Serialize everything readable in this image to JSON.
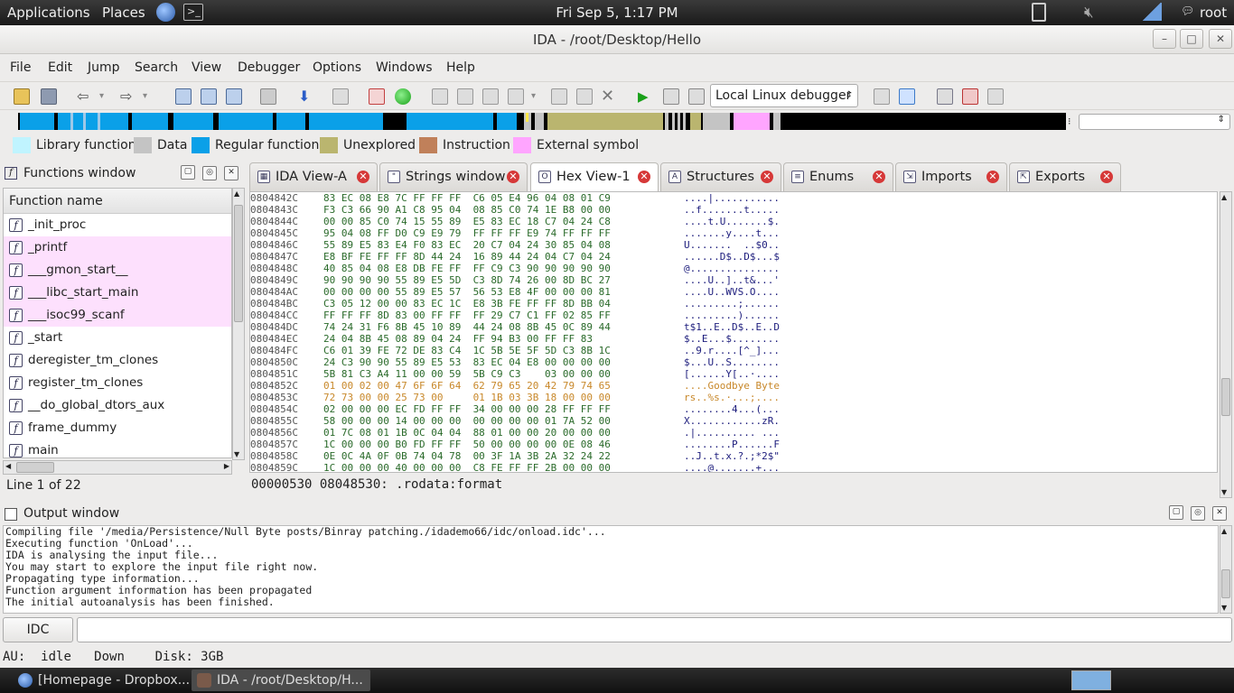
{
  "top_panel": {
    "applications": "Applications",
    "places": "Places",
    "clock": "Fri Sep  5,  1:17 PM",
    "user": "root"
  },
  "window": {
    "title": "IDA - /root/Desktop/Hello"
  },
  "menu": [
    "File",
    "Edit",
    "Jump",
    "Search",
    "View",
    "Debugger",
    "Options",
    "Windows",
    "Help"
  ],
  "toolbar": {
    "debugger_select": "Local Linux debugger"
  },
  "legend": [
    {
      "label": "Library function",
      "color": "#c0f4ff"
    },
    {
      "label": "Data",
      "color": "#c4c4c4"
    },
    {
      "label": "Regular function",
      "color": "#0aa0e8"
    },
    {
      "label": "Unexplored",
      "color": "#bab56f"
    },
    {
      "label": "Instruction",
      "color": "#c0805a"
    },
    {
      "label": "External symbol",
      "color": "#ffa5ff"
    }
  ],
  "functions_window": {
    "title": "Functions window",
    "column": "Function name",
    "items": [
      "_init_proc",
      "_printf",
      "___gmon_start__",
      "___libc_start_main",
      "___isoc99_scanf",
      "_start",
      "deregister_tm_clones",
      "register_tm_clones",
      "__do_global_dtors_aux",
      "frame_dummy",
      "main"
    ],
    "status": "Line 1 of 22"
  },
  "tabs": [
    {
      "label": "IDA View-A",
      "icon": "graph-icon"
    },
    {
      "label": "Strings window",
      "icon": "string-icon"
    },
    {
      "label": "Hex View-1",
      "icon": "hex-icon"
    },
    {
      "label": "Structures",
      "icon": "struct-icon"
    },
    {
      "label": "Enums",
      "icon": "enum-icon"
    },
    {
      "label": "Imports",
      "icon": "import-icon"
    },
    {
      "label": "Exports",
      "icon": "export-icon"
    }
  ],
  "hex_rows": [
    {
      "addr": "0804842C",
      "hex": "83 EC 08 E8 7C FF FF FF  C6 05 E4 96 04 08 01 C9",
      "ascii": "....|..........."
    },
    {
      "addr": "0804843C",
      "hex": "F3 C3 66 90 A1 C8 95 04  08 85 C0 74 1E B8 00 00",
      "ascii": "..f.......t....."
    },
    {
      "addr": "0804844C",
      "hex": "00 00 85 C0 74 15 55 89  E5 83 EC 18 C7 04 24 C8",
      "ascii": "....t.U.......$."
    },
    {
      "addr": "0804845C",
      "hex": "95 04 08 FF D0 C9 E9 79  FF FF FF E9 74 FF FF FF",
      "ascii": ".......y....t..."
    },
    {
      "addr": "0804846C",
      "hex": "55 89 E5 83 E4 F0 83 EC  20 C7 04 24 30 85 04 08",
      "ascii": "U.......  ..$0.."
    },
    {
      "addr": "0804847C",
      "hex": "E8 BF FE FF FF 8D 44 24  16 89 44 24 04 C7 04 24",
      "ascii": "......D$..D$...$"
    },
    {
      "addr": "0804848C",
      "hex": "40 85 04 08 E8 DB FE FF  FF C9 C3 90 90 90 90 90",
      "ascii": "@..............."
    },
    {
      "addr": "0804849C",
      "hex": "90 90 90 90 55 89 E5 5D  C3 8D 74 26 00 8D BC 27",
      "ascii": "....U..]..t&...'"
    },
    {
      "addr": "080484AC",
      "hex": "00 00 00 00 55 89 E5 57  56 53 E8 4F 00 00 00 81",
      "ascii": "....U..WVS.O...."
    },
    {
      "addr": "080484BC",
      "hex": "C3 05 12 00 00 83 EC 1C  E8 3B FE FF FF 8D BB 04",
      "ascii": ".........;......"
    },
    {
      "addr": "080484CC",
      "hex": "FF FF FF 8D 83 00 FF FF  FF 29 C7 C1 FF 02 85 FF",
      "ascii": ".........)......"
    },
    {
      "addr": "080484DC",
      "hex": "74 24 31 F6 8B 45 10 89  44 24 08 8B 45 0C 89 44",
      "ascii": "t$1..E..D$..E..D"
    },
    {
      "addr": "080484EC",
      "hex": "24 04 8B 45 08 89 04 24  FF 94 B3 00 FF FF 83",
      "ascii": "$..E...$........"
    },
    {
      "addr": "080484FC",
      "hex": "C6 01 39 FE 72 DE 83 C4  1C 5B 5E 5F 5D C3 8B 1C",
      "ascii": "..9.r....[^_]..."
    },
    {
      "addr": "0804850C",
      "hex": "24 C3 90 90 55 89 E5 53  83 EC 04 E8 00 00 00 00",
      "ascii": "$...U..S........"
    },
    {
      "addr": "0804851C",
      "hex": "5B 81 C3 A4 11 00 00 59  5B C9 C3    03 00 00 00",
      "ascii": "[......Y[..·...."
    },
    {
      "addr": "0804852C",
      "hex": "01 00 02 00 47 6F 6F 64  62 79 65 20 42 79 74 65",
      "ascii": "....Goodbye Byte"
    },
    {
      "addr": "0804853C",
      "hex": "72 73 00 00 25 73 00     01 1B 03 3B 18 00 00 00",
      "ascii": "rs..%s.·...;...."
    },
    {
      "addr": "0804854C",
      "hex": "02 00 00 00 EC FD FF FF  34 00 00 00 28 FF FF FF",
      "ascii": "........4...(..."
    },
    {
      "addr": "0804855C",
      "hex": "58 00 00 00 14 00 00 00  00 00 00 00 01 7A 52 00",
      "ascii": "X............zR."
    },
    {
      "addr": "0804856C",
      "hex": "01 7C 08 01 1B 0C 04 04  88 01 00 00 20 00 00 00",
      "ascii": ".|.......... ..."
    },
    {
      "addr": "0804857C",
      "hex": "1C 00 00 00 B0 FD FF FF  50 00 00 00 00 0E 08 46",
      "ascii": "........P......F"
    },
    {
      "addr": "0804858C",
      "hex": "0E 0C 4A 0F 0B 74 04 78  00 3F 1A 3B 2A 32 24 22",
      "ascii": "..J..t.x.?.;*2$\""
    },
    {
      "addr": "0804859C",
      "hex": "1C 00 00 00 40 00 00 00  C8 FE FF FF 2B 00 00 00",
      "ascii": "....@.......+..."
    }
  ],
  "hex_status": "00000530 08048530: .rodata:format",
  "output": {
    "title": "Output window",
    "lines": [
      "Compiling file '/media/Persistence/Null Byte posts/Binray patching./idademo66/idc/onload.idc'...",
      "Executing function 'OnLoad'...",
      "IDA is analysing the input file...",
      "You may start to explore the input file right now.",
      "Propagating type information...",
      "Function argument information has been propagated",
      "The initial autoanalysis has been finished."
    ]
  },
  "idc_button": "IDC",
  "status": {
    "au": "AU:",
    "state": "idle",
    "direction": "Down",
    "disk": "Disk: 3GB"
  },
  "taskbar": [
    {
      "label": "[Homepage - Dropbox...",
      "active": false
    },
    {
      "label": "IDA - /root/Desktop/H...",
      "active": true
    }
  ]
}
